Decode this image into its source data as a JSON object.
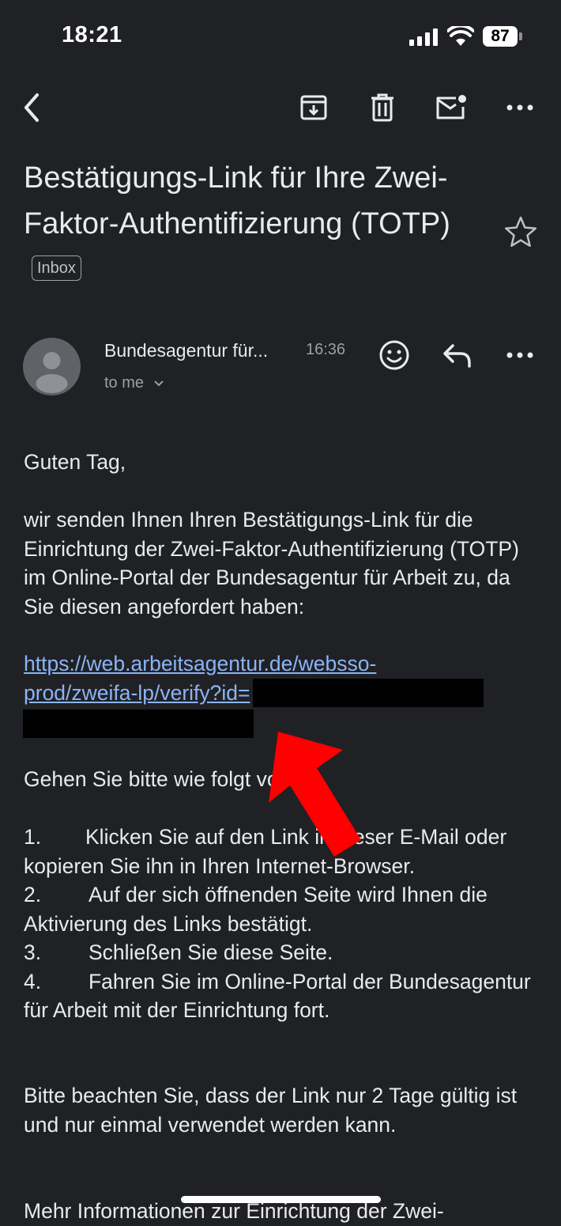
{
  "status_bar": {
    "time": "18:21",
    "battery": "87"
  },
  "email": {
    "subject": "Bestätigungs-Link für Ihre Zwei-Faktor-Authentifizierung (TOTP)",
    "label": "Inbox",
    "sender": "Bundesagentur für...",
    "time": "16:36",
    "recipient": "to me",
    "greeting": "Guten Tag,",
    "intro": "wir senden Ihnen Ihren Bestätigungs-Link für die Einrichtung der Zwei-Faktor-Authentifizierung (TOTP) im Online-Portal der Bundesagentur für Arbeit zu, da Sie diesen angefordert haben:",
    "link_line1": "https://web.arbeitsagentur.de/websso-",
    "link_line2": "prod/zweifa-lp/verify?id=",
    "instructions_intro": "Gehen Sie bitte wie folgt vor:",
    "steps": [
      {
        "num": "1.",
        "text": "Klicken Sie auf den Link in dieser E-Mail oder kopieren Sie ihn in Ihren Internet-Browser."
      },
      {
        "num": "2.",
        "text": "Auf der sich öffnenden Seite wird Ihnen die Aktivierung des Links bestätigt."
      },
      {
        "num": "3.",
        "text": "Schließen Sie diese Seite."
      },
      {
        "num": "4.",
        "text": "Fahren Sie im Online-Portal der Bundesagentur für Arbeit mit der Einrichtung fort."
      }
    ],
    "note": "Bitte beachten Sie, dass der Link nur 2 Tage gültig ist und nur einmal verwendet werden kann.",
    "more_info": "Mehr Informationen zur Einrichtung der Zwei-"
  },
  "icons": [
    "back-icon",
    "archive-icon",
    "delete-icon",
    "mark-unread-icon",
    "more-icon",
    "star-icon",
    "avatar-icon",
    "emoji-react-icon",
    "reply-icon",
    "more-icon",
    "chevron-down-icon",
    "arrow-annotation-icon"
  ],
  "colors": {
    "background": "#202124",
    "text": "#e8eaed",
    "link": "#8ab4f8",
    "secondary": "#9aa0a6",
    "annotation": "#ff0000"
  }
}
